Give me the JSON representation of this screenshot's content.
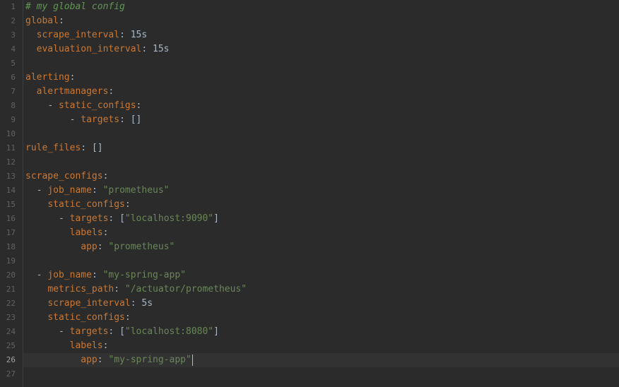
{
  "editor": {
    "current_line": 26,
    "lines": [
      {
        "n": "1",
        "indent": "",
        "comment": "# my global config"
      },
      {
        "n": "2",
        "indent": "",
        "key": "global",
        "sep": ":"
      },
      {
        "n": "3",
        "indent": "  ",
        "key": "scrape_interval",
        "sep": ": ",
        "val": "15s"
      },
      {
        "n": "4",
        "indent": "  ",
        "key": "evaluation_interval",
        "sep": ": ",
        "val": "15s"
      },
      {
        "n": "5"
      },
      {
        "n": "6",
        "indent": "",
        "key": "alerting",
        "sep": ":"
      },
      {
        "n": "7",
        "indent": "  ",
        "key": "alertmanagers",
        "sep": ":"
      },
      {
        "n": "8",
        "indent": "    ",
        "dash": "- ",
        "key": "static_configs",
        "sep": ":"
      },
      {
        "n": "9",
        "indent": "        ",
        "dash": "- ",
        "key": "targets",
        "sep": ": ",
        "val": "[]"
      },
      {
        "n": "10"
      },
      {
        "n": "11",
        "indent": "",
        "key": "rule_files",
        "sep": ": ",
        "val": "[]"
      },
      {
        "n": "12"
      },
      {
        "n": "13",
        "indent": "",
        "key": "scrape_configs",
        "sep": ":"
      },
      {
        "n": "14",
        "indent": "  ",
        "dash": "- ",
        "key": "job_name",
        "sep": ": ",
        "str": "\"prometheus\""
      },
      {
        "n": "15",
        "indent": "    ",
        "key": "static_configs",
        "sep": ":"
      },
      {
        "n": "16",
        "indent": "      ",
        "dash": "- ",
        "key": "targets",
        "sep": ": ",
        "pre": "[",
        "str": "\"localhost:9090\"",
        "post": "]"
      },
      {
        "n": "17",
        "indent": "        ",
        "key": "labels",
        "sep": ":"
      },
      {
        "n": "18",
        "indent": "          ",
        "key": "app",
        "sep": ": ",
        "str": "\"prometheus\""
      },
      {
        "n": "19"
      },
      {
        "n": "20",
        "indent": "  ",
        "dash": "- ",
        "key": "job_name",
        "sep": ": ",
        "str": "\"my-spring-app\""
      },
      {
        "n": "21",
        "indent": "    ",
        "key": "metrics_path",
        "sep": ": ",
        "str": "\"/actuator/prometheus\""
      },
      {
        "n": "22",
        "indent": "    ",
        "key": "scrape_interval",
        "sep": ": ",
        "val": "5s"
      },
      {
        "n": "23",
        "indent": "    ",
        "key": "static_configs",
        "sep": ":"
      },
      {
        "n": "24",
        "indent": "      ",
        "dash": "- ",
        "key": "targets",
        "sep": ": ",
        "pre": "[",
        "str": "\"localhost:8080\"",
        "post": "]"
      },
      {
        "n": "25",
        "indent": "        ",
        "key": "labels",
        "sep": ":"
      },
      {
        "n": "26",
        "indent": "          ",
        "key": "app",
        "sep": ": ",
        "str": "\"my-spring-app\""
      },
      {
        "n": "27"
      }
    ]
  }
}
